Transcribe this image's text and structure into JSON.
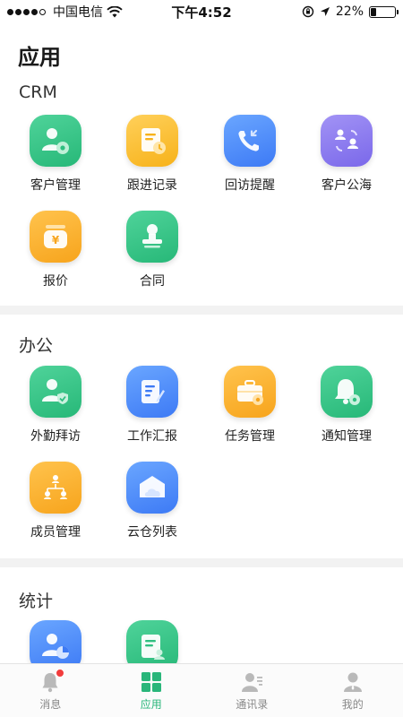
{
  "status_bar": {
    "carrier": "中国电信",
    "time": "下午4:52",
    "battery_percent": "22%",
    "battery_level": 0.22
  },
  "page": {
    "title": "应用"
  },
  "sections": {
    "crm": {
      "title": "CRM",
      "items": [
        {
          "label": "客户管理",
          "icon": "customer-manage-icon",
          "color": "#2fbf80"
        },
        {
          "label": "跟进记录",
          "icon": "follow-record-icon",
          "color": "#f7b21a"
        },
        {
          "label": "回访提醒",
          "icon": "callback-reminder-icon",
          "color": "#3d7af5"
        },
        {
          "label": "客户公海",
          "icon": "customer-pool-icon",
          "color": "#7a68ea"
        },
        {
          "label": "报价",
          "icon": "quote-icon",
          "color": "#f7a41c"
        },
        {
          "label": "合同",
          "icon": "contract-icon",
          "color": "#2fbf80"
        }
      ]
    },
    "office": {
      "title": "办公",
      "items": [
        {
          "label": "外勤拜访",
          "icon": "field-visit-icon",
          "color": "#2fbf80"
        },
        {
          "label": "工作汇报",
          "icon": "work-report-icon",
          "color": "#3d7af5"
        },
        {
          "label": "任务管理",
          "icon": "task-manage-icon",
          "color": "#f7a41c"
        },
        {
          "label": "通知管理",
          "icon": "notice-manage-icon",
          "color": "#2fbf80"
        },
        {
          "label": "成员管理",
          "icon": "member-manage-icon",
          "color": "#f7a41c"
        },
        {
          "label": "云仓列表",
          "icon": "cloud-warehouse-icon",
          "color": "#3d7af5"
        }
      ]
    },
    "stats": {
      "title": "统计",
      "items": [
        {
          "label": "",
          "icon": "stats-chart-icon",
          "color": "#3d7af5"
        },
        {
          "label": "",
          "icon": "stats-report-icon",
          "color": "#2fbf80"
        }
      ]
    }
  },
  "tab_bar": {
    "tabs": [
      {
        "label": "消息",
        "icon": "bell-icon",
        "active": false
      },
      {
        "label": "应用",
        "icon": "apps-grid-icon",
        "active": true
      },
      {
        "label": "通讯录",
        "icon": "contacts-icon",
        "active": false
      },
      {
        "label": "我的",
        "icon": "profile-icon",
        "active": false
      }
    ]
  }
}
